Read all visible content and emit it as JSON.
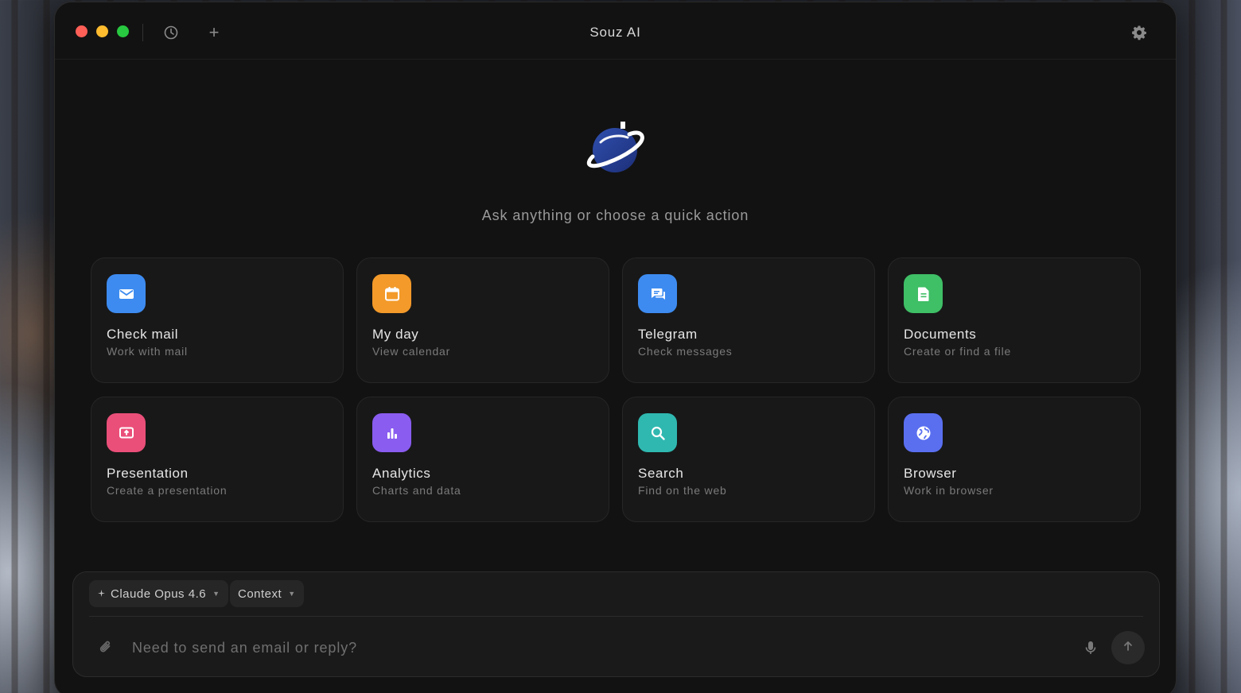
{
  "app": {
    "title": "Souz AI"
  },
  "titlebar": {
    "history_icon": "clock-icon",
    "new_icon": "plus-icon",
    "new_label": "+",
    "settings_icon": "gear-icon"
  },
  "hero": {
    "subtitle": "Ask anything or choose a quick action"
  },
  "actions": [
    {
      "title": "Check mail",
      "subtitle": "Work with mail",
      "icon": "mail-icon",
      "color": "#3d8bf0"
    },
    {
      "title": "My day",
      "subtitle": "View calendar",
      "icon": "calendar-icon",
      "color": "#f39a2a"
    },
    {
      "title": "Telegram",
      "subtitle": "Check messages",
      "icon": "chat-icon",
      "color": "#3d8bf0"
    },
    {
      "title": "Documents",
      "subtitle": "Create or find a file",
      "icon": "document-icon",
      "color": "#3fbf66"
    },
    {
      "title": "Presentation",
      "subtitle": "Create a presentation",
      "icon": "presentation-icon",
      "color": "#ea4f79"
    },
    {
      "title": "Analytics",
      "subtitle": "Charts and data",
      "icon": "bar-chart-icon",
      "color": "#8a5cf0"
    },
    {
      "title": "Search",
      "subtitle": "Find on the web",
      "icon": "search-icon",
      "color": "#2fb8b0"
    },
    {
      "title": "Browser",
      "subtitle": "Work in browser",
      "icon": "globe-icon",
      "color": "#5a6ff0"
    }
  ],
  "composer": {
    "model_label": "Claude Opus 4.6",
    "context_label": "Context",
    "placeholder": "Need to send an email or reply?"
  }
}
